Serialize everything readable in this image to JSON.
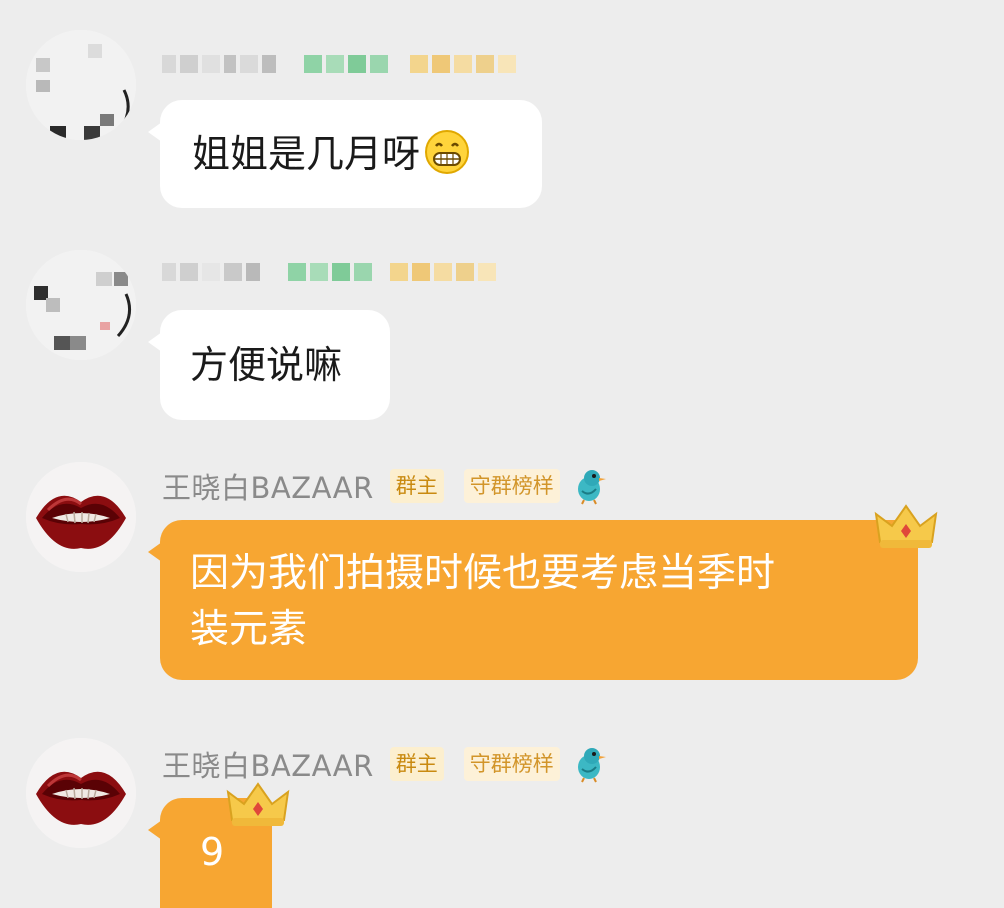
{
  "messages": [
    {
      "sender": "",
      "name_blurred": true,
      "text": "姐姐是几月呀",
      "emoji": "grinning-face-emoji"
    },
    {
      "sender": "",
      "name_blurred": true,
      "text": "方便说嘛"
    },
    {
      "sender": "王晓白BAZAAR",
      "badges": [
        "群主",
        "守群榜样"
      ],
      "text_lines": [
        "因为我们拍摄时候也要考虑当季时",
        "装元素"
      ]
    },
    {
      "sender": "王晓白BAZAAR",
      "badges": [
        "群主",
        "守群榜样"
      ],
      "text": "9"
    }
  ],
  "colors": {
    "background": "#ededed",
    "incoming_bubble": "#ffffff",
    "owner_bubble": "#f7a632",
    "badge_text": "#c98a10"
  },
  "icons": [
    "blurred-avatar",
    "lips-avatar",
    "grinning-face-emoji",
    "blue-bird-icon",
    "crown-icon"
  ]
}
